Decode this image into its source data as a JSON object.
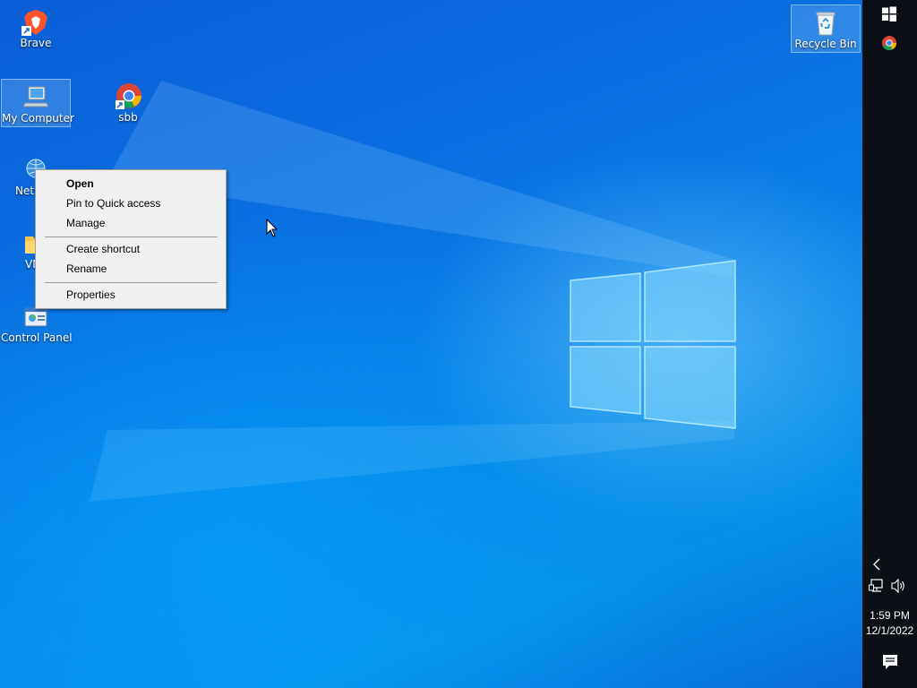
{
  "desktop": {
    "icons": [
      {
        "id": "brave",
        "label": "Brave",
        "icon": "brave-icon",
        "selected": false
      },
      {
        "id": "my-computer",
        "label": "My Computer",
        "icon": "computer-icon",
        "selected": true
      },
      {
        "id": "sbb",
        "label": "sbb",
        "icon": "chrome-icon",
        "selected": false
      },
      {
        "id": "network",
        "label": "Netw",
        "icon": "network-icon",
        "selected": false
      },
      {
        "id": "vm",
        "label": "VM",
        "icon": "folder-icon",
        "selected": false
      },
      {
        "id": "control-panel",
        "label": "Control Panel",
        "icon": "control-panel-icon",
        "selected": false
      },
      {
        "id": "recycle-bin",
        "label": "Recycle Bin",
        "icon": "recycle-bin-icon",
        "selected": true
      }
    ]
  },
  "context_menu": {
    "items": [
      {
        "label": "Open",
        "bold": true
      },
      {
        "label": "Pin to Quick access",
        "bold": false
      },
      {
        "label": "Manage",
        "bold": false
      },
      {
        "label": "Create shortcut",
        "bold": false
      },
      {
        "label": "Rename",
        "bold": false
      },
      {
        "label": "Properties",
        "bold": false
      }
    ]
  },
  "taskbar": {
    "start_icon": "windows-start-icon",
    "pinned": [
      {
        "icon": "chrome-icon"
      }
    ],
    "tray": {
      "chevron_icon": "chevron-left-icon",
      "network_icon": "network-status-icon",
      "volume_icon": "speaker-icon",
      "notifications_icon": "action-center-icon"
    },
    "clock": {
      "time": "1:59 PM",
      "date": "12/1/2022"
    }
  },
  "colors": {
    "wallpaper_blue": "#0a6ee0",
    "taskbar_bg": "#0c0f16",
    "menu_bg": "#f0f0f0",
    "selection": "#78b4f0"
  }
}
